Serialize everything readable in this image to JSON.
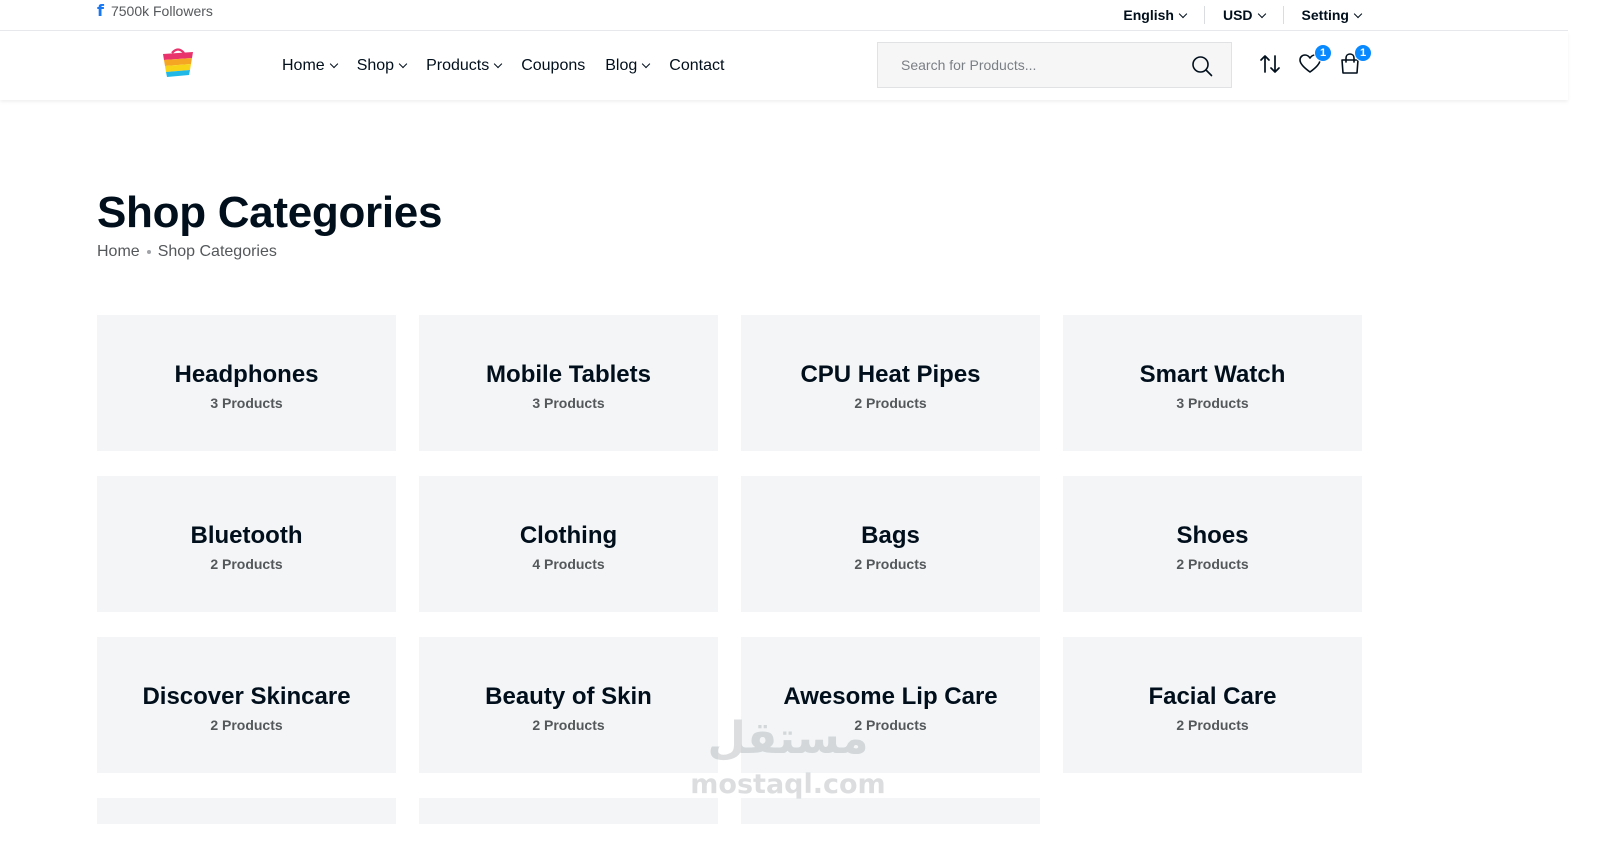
{
  "topbar": {
    "social_icon": "facebook-icon",
    "followers": "7500k Followers",
    "language": "English",
    "currency": "USD",
    "setting": "Setting"
  },
  "header": {
    "nav": [
      {
        "label": "Home",
        "dropdown": true
      },
      {
        "label": "Shop",
        "dropdown": true
      },
      {
        "label": "Products",
        "dropdown": true
      },
      {
        "label": "Coupons",
        "dropdown": false
      },
      {
        "label": "Blog",
        "dropdown": true
      },
      {
        "label": "Contact",
        "dropdown": false
      }
    ],
    "search_placeholder": "Search for Products...",
    "wishlist_count": "1",
    "cart_count": "1",
    "accent": "#0989ff"
  },
  "page": {
    "title": "Shop Categories",
    "breadcrumb": [
      "Home",
      "Shop Categories"
    ]
  },
  "categories": [
    {
      "name": "Headphones",
      "count": "3 Products"
    },
    {
      "name": "Mobile Tablets",
      "count": "3 Products"
    },
    {
      "name": "CPU Heat Pipes",
      "count": "2 Products"
    },
    {
      "name": "Smart Watch",
      "count": "3 Products"
    },
    {
      "name": "Bluetooth",
      "count": "2 Products"
    },
    {
      "name": "Clothing",
      "count": "4 Products"
    },
    {
      "name": "Bags",
      "count": "2 Products"
    },
    {
      "name": "Shoes",
      "count": "2 Products"
    },
    {
      "name": "Discover Skincare",
      "count": "2 Products"
    },
    {
      "name": "Beauty of Skin",
      "count": "2 Products"
    },
    {
      "name": "Awesome Lip Care",
      "count": "2 Products"
    },
    {
      "name": "Facial Care",
      "count": "2 Products"
    }
  ],
  "watermark": {
    "arabic": "مستقل",
    "latin": "mostaql.com"
  }
}
